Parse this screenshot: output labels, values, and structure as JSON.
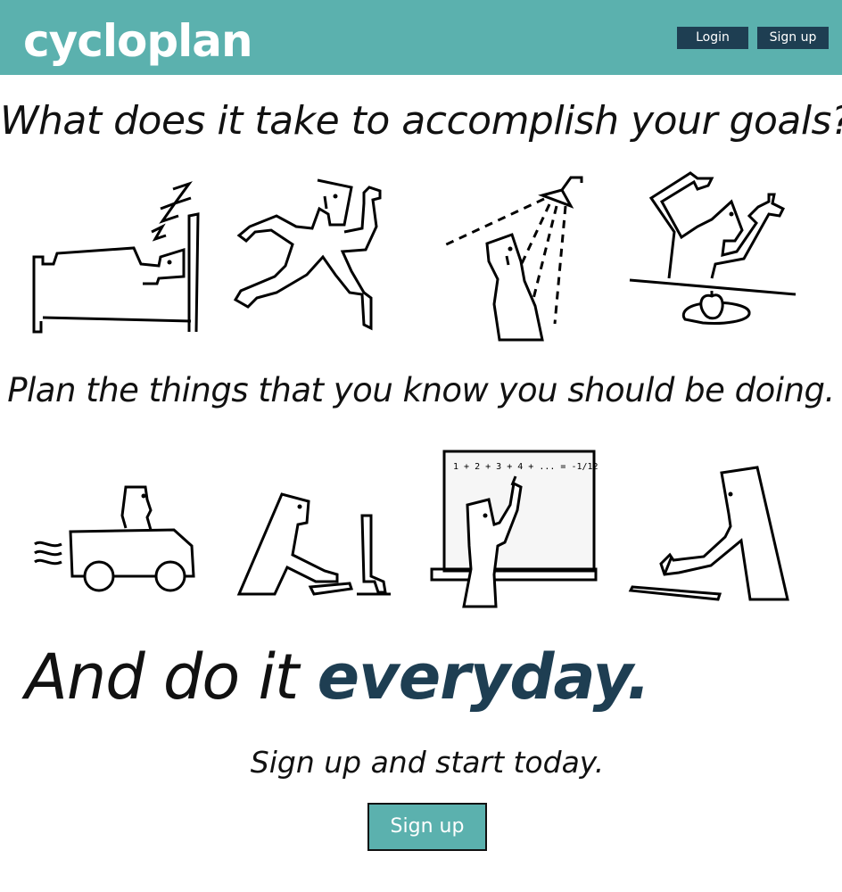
{
  "header": {
    "logo_text": "cycloplan",
    "login_label": "Login",
    "signup_label": "Sign up",
    "background_color": "#5bb1ae",
    "button_color": "#1e3e52"
  },
  "main": {
    "headline_1": "What does it take to accomplish your goals?",
    "headline_2": "Plan the things that you know you should be doing.",
    "headline_3_prefix": "And do it ",
    "headline_3_emphasis": "everyday.",
    "cta_text": "Sign up and start today.",
    "cta_button_label": "Sign up",
    "whiteboard_equation": "1 + 2 + 3 + 4 + ... = -1/12",
    "accent_color": "#1e3e52"
  },
  "illustrations": {
    "row_1": [
      "sleeping-in-bed-icon",
      "running-person-icon",
      "person-showering-icon",
      "person-chopping-apple-icon"
    ],
    "row_2": [
      "person-driving-car-icon",
      "person-typing-computer-icon",
      "person-at-whiteboard-icon",
      "person-writing-icon"
    ]
  }
}
